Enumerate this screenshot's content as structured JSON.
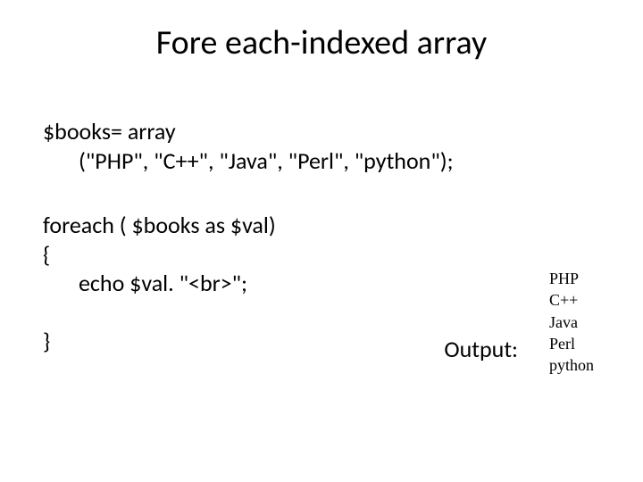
{
  "title": "Fore each-indexed array",
  "code": {
    "line1": "$books= array",
    "line2": "(\"PHP\", \"C++\", \"Java\", \"Perl\", \"python\");",
    "line3": "foreach ( $books as $val)",
    "line4": "{",
    "line5": "echo $val. \"<br>\";",
    "line6": "}"
  },
  "output_label": "Output:",
  "output_lines": [
    "PHP",
    "C++",
    "Java",
    "Perl",
    "python"
  ]
}
